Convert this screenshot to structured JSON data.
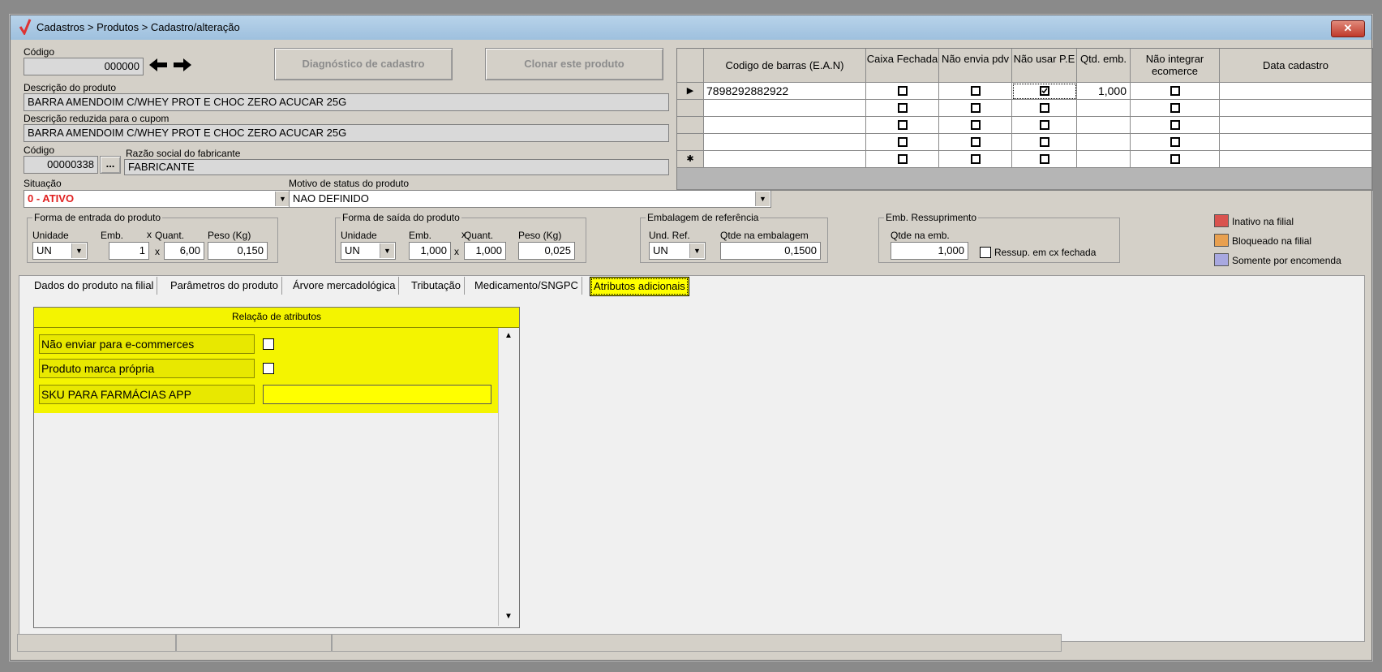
{
  "window": {
    "title": "Cadastros > Produtos > Cadastro/alteração",
    "close_label": "✕"
  },
  "top": {
    "codigo_label": "Código",
    "codigo_value": "000000",
    "diag_button": "Diagnóstico de cadastro",
    "clone_button": "Clonar este produto",
    "descricao_label": "Descrição  do produto",
    "descricao_value": "BARRA AMENDOIM C/WHEY PROT E CHOC ZERO ACUCAR 25G",
    "reduzida_label": "Descrição reduzida para o cupom",
    "reduzida_value": "BARRA AMENDOIM C/WHEY PROT E CHOC ZERO ACUCAR 25G",
    "fab_codigo_label": "Código",
    "fab_codigo_value": "00000338",
    "fab_browse": "...",
    "razao_label": "Razão social do fabricante",
    "razao_value": "FABRICANTE",
    "situacao_label": "Situação",
    "situacao_value": "0 - ATIVO",
    "motivo_label": "Motivo de status do produto",
    "motivo_value": "NAO DEFINIDO"
  },
  "entrada": {
    "title": "Forma de entrada do produto",
    "unidade_label": "Unidade",
    "emb_label": "Emb.",
    "quant_label": "Quant.",
    "peso_label": "Peso (Kg)",
    "unidade": "UN",
    "emb": "1",
    "quant": "6,00",
    "peso": "0,150",
    "x": "x"
  },
  "saida": {
    "title": "Forma de saída do produto",
    "unidade_label": "Unidade",
    "emb_label": "Emb.",
    "quant_label": "Quant.",
    "peso_label": "Peso (Kg)",
    "unidade": "UN",
    "emb": "1,000",
    "quant": "1,000",
    "peso": "0,025",
    "x": "x"
  },
  "embalagem": {
    "title": "Embalagem de referência",
    "und_label": "Und. Ref.",
    "qtde_label": "Qtde na embalagem",
    "und": "UN",
    "qtde": "0,1500"
  },
  "ressup": {
    "title": "Emb. Ressuprimento",
    "qtde_label": "Qtde na emb.",
    "qtde": "1,000",
    "check_label": "Ressup. em cx fechada"
  },
  "legend": {
    "items": [
      {
        "label": "Inativo na filial",
        "color": "#d9534f"
      },
      {
        "label": "Bloqueado na filial",
        "color": "#e8a050"
      },
      {
        "label": "Somente por encomenda",
        "color": "#a8a8e0"
      }
    ]
  },
  "grid": {
    "headers": [
      "Codigo de barras (E.A.N)",
      "Caixa Fechada",
      "Não envia pdv",
      "Não usar P.E",
      "Qtd. emb.",
      "Não integrar ecomerce",
      "Data cadastro"
    ],
    "row1": {
      "ean": "7898292882922",
      "qtd": "1,000",
      "indicator": "▶"
    },
    "new_row_indicator": "✱"
  },
  "tabs": [
    "Dados do produto na filial",
    "Parâmetros do produto",
    "Árvore mercadológica",
    "Tributação",
    "Medicamento/SNGPC",
    "Atributos adicionais"
  ],
  "attributes": {
    "header": "Relação de atributos",
    "items": [
      {
        "label": "Não enviar para e-commerces"
      },
      {
        "label": "Produto marca própria"
      },
      {
        "label": "SKU PARA FARMÁCIAS APP",
        "value": ""
      }
    ]
  }
}
